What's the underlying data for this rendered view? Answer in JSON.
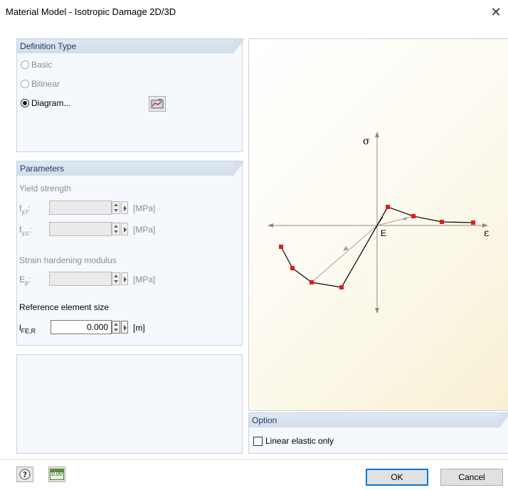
{
  "window": {
    "title": "Material Model - Isotropic Damage 2D/3D",
    "close_glyph": "✕"
  },
  "definition_type": {
    "header": "Definition Type",
    "options": [
      {
        "label": "Basic",
        "checked": false,
        "enabled": false
      },
      {
        "label": "Bilinear",
        "checked": false,
        "enabled": false
      },
      {
        "label": "Diagram...",
        "checked": true,
        "enabled": true
      }
    ],
    "edit_diagram_icon": "edit-diagram-icon"
  },
  "parameters": {
    "header": "Parameters",
    "yield_strength_label": "Yield strength",
    "fyt_symbol": "f",
    "fyt_sub": "y,t",
    "fyc_symbol": "f",
    "fyc_sub": "y,c",
    "unit_mpa": "[MPa]",
    "strain_hardening_label": "Strain hardening modulus",
    "ep_symbol": "E",
    "ep_sub": "p",
    "ref_size_label": "Reference element size",
    "lfe_symbol": "l",
    "lfe_sub": "FE,R",
    "lfe_value": "0.000",
    "unit_m": "[m]",
    "colon": ":"
  },
  "diagram": {
    "sigma": "σ",
    "epsilon": "ε",
    "e_label": "E",
    "line_color": "#111111",
    "point_color": "#e01b1b",
    "axis_color": "#8a8a8a"
  },
  "option": {
    "header": "Option",
    "linear_elastic_label": "Linear elastic only",
    "linear_elastic_checked": false
  },
  "footer": {
    "help_icon": "help-icon",
    "units_icon": "decimal-places-icon",
    "units_icon_text": "0.00",
    "ok_label": "OK",
    "cancel_label": "Cancel"
  }
}
